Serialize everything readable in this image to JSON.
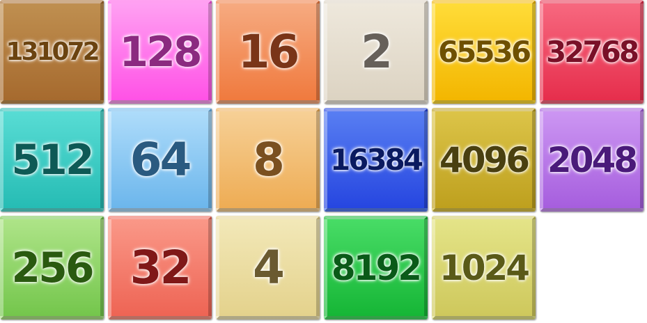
{
  "tiles": [
    {
      "value": "131072",
      "top": "#bf8f50",
      "bottom": "#a66a2e",
      "text": "#6b4310"
    },
    {
      "value": "128",
      "top": "#ffa0f2",
      "bottom": "#ff52e6",
      "text": "#8b2a80"
    },
    {
      "value": "16",
      "top": "#f6aa80",
      "bottom": "#f07a3e",
      "text": "#7a3518"
    },
    {
      "value": "2",
      "top": "#eee8dc",
      "bottom": "#dcd3c2",
      "text": "#66605a"
    },
    {
      "value": "65536",
      "top": "#ffdc38",
      "bottom": "#f3b600",
      "text": "#6e5000"
    },
    {
      "value": "32768",
      "top": "#f7687f",
      "bottom": "#e62e4c",
      "text": "#7a1028"
    },
    {
      "value": "512",
      "top": "#58dcd4",
      "bottom": "#26bcb4",
      "text": "#0e5a56"
    },
    {
      "value": "64",
      "top": "#aedcfa",
      "bottom": "#6cb6ec",
      "text": "#2a5a80"
    },
    {
      "value": "8",
      "top": "#f6d096",
      "bottom": "#eeac54",
      "text": "#7a5020"
    },
    {
      "value": "16384",
      "top": "#587ef2",
      "bottom": "#2646e0",
      "text": "#0a1a60"
    },
    {
      "value": "4096",
      "top": "#dcc448",
      "bottom": "#bea01e",
      "text": "#4a4010"
    },
    {
      "value": "2048",
      "top": "#cc96f2",
      "bottom": "#a65ede",
      "text": "#4a1a7a"
    },
    {
      "value": "256",
      "top": "#aee488",
      "bottom": "#74c64c",
      "text": "#2a5a10"
    },
    {
      "value": "32",
      "top": "#fa9888",
      "bottom": "#ee6454",
      "text": "#801818"
    },
    {
      "value": "4",
      "top": "#f2e8b8",
      "bottom": "#e4d28c",
      "text": "#6a5a30"
    },
    {
      "value": "8192",
      "top": "#48dc66",
      "bottom": "#16b636",
      "text": "#0a5a18"
    },
    {
      "value": "1024",
      "top": "#e4e488",
      "bottom": "#cec85c",
      "text": "#5a5a18"
    }
  ]
}
